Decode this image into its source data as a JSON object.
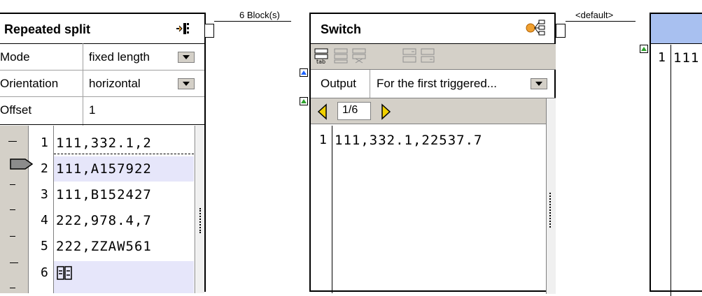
{
  "repeated_split": {
    "title": "Repeated split",
    "properties": [
      {
        "label": "Mode",
        "value": "fixed length"
      },
      {
        "label": "Orientation",
        "value": "horizontal"
      },
      {
        "label": "Offset",
        "value": "1"
      }
    ],
    "lines": [
      {
        "num": "1",
        "text": "111,332.1,2"
      },
      {
        "num": "2",
        "text": "111,A157922"
      },
      {
        "num": "3",
        "text": "111,B152427"
      },
      {
        "num": "4",
        "text": "222,978.4,7"
      },
      {
        "num": "5",
        "text": "222,ZZAW561"
      },
      {
        "num": "6",
        "text": ""
      }
    ]
  },
  "connector1": {
    "label": "6 Block(s)"
  },
  "switch": {
    "title": "Switch",
    "output_label": "Output",
    "output_value": "For the first triggered...",
    "page_indicator": "1/6",
    "lines": [
      {
        "num": "1",
        "text": "111,332.1,22537.7"
      }
    ]
  },
  "connector2": {
    "label": "<default>"
  },
  "right_panel": {
    "lines": [
      {
        "num": "1",
        "text": "111"
      }
    ]
  },
  "colors": {
    "highlight_row": "#e6e6fa",
    "toolbar_bg": "#d4d0c8",
    "header_blue": "#a8c0f0"
  }
}
